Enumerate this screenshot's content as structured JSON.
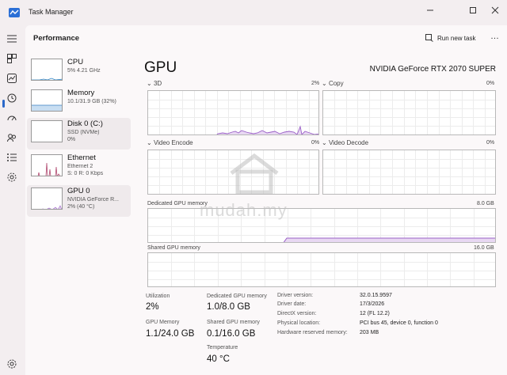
{
  "window": {
    "title": "Task Manager",
    "minimize_icon": "minimize-icon",
    "maximize_icon": "maximize-icon",
    "close_icon": "close-icon"
  },
  "rail": [
    "hamburger-icon",
    "processes-icon",
    "performance-icon",
    "app-history-icon",
    "startup-apps-icon",
    "users-icon",
    "details-icon",
    "services-icon",
    "settings-icon"
  ],
  "header": {
    "title": "Performance",
    "run_new_task": "Run new task",
    "more": "…"
  },
  "sidebar": {
    "items": [
      {
        "name": "CPU",
        "line1": "5% 4.21 GHz",
        "line2": ""
      },
      {
        "name": "Memory",
        "line1": "10.1/31.9 GB (32%)",
        "line2": ""
      },
      {
        "name": "Disk 0 (C:)",
        "line1": "SSD (NVMe)",
        "line2": "0%"
      },
      {
        "name": "Ethernet",
        "line1": "Ethernet 2",
        "line2": "S: 0 R: 0 Kbps"
      },
      {
        "name": "GPU 0",
        "line1": "NVIDIA GeForce R...",
        "line2": "2% (40 °C)"
      }
    ]
  },
  "main": {
    "title": "GPU",
    "model": "NVIDIA GeForce RTX 2070 SUPER",
    "engines": [
      {
        "label": "3D",
        "value": "2%"
      },
      {
        "label": "Copy",
        "value": "0%"
      },
      {
        "label": "Video Encode",
        "value": "0%"
      },
      {
        "label": "Video Decode",
        "value": "0%"
      }
    ],
    "dedicated_label": "Dedicated GPU memory",
    "dedicated_max": "8.0 GB",
    "shared_label": "Shared GPU memory",
    "shared_max": "16.0 GB",
    "stats": {
      "utilization_label": "Utilization",
      "utilization_value": "2%",
      "gpu_memory_label": "GPU Memory",
      "gpu_memory_value": "1.1/24.0 GB",
      "dedicated_label": "Dedicated GPU memory",
      "dedicated_value": "1.0/8.0 GB",
      "shared_label": "Shared GPU memory",
      "shared_value": "0.1/16.0 GB",
      "temperature_label": "Temperature",
      "temperature_value": "40 °C"
    },
    "info": [
      {
        "label": "Driver version:",
        "value": "32.0.15.9597"
      },
      {
        "label": "Driver date:",
        "value": "17/3/2026"
      },
      {
        "label": "DirectX version:",
        "value": "12 (FL 12.2)"
      },
      {
        "label": "Physical location:",
        "value": "PCI bus 45, device 0, function 0"
      },
      {
        "label": "Hardware reserved memory:",
        "value": "203 MB"
      }
    ]
  },
  "watermark": "mudah.my",
  "colors": {
    "gpu_accent": "#9a5fc7",
    "gpu_fill": "#e8d8f2",
    "memory_fill": "#c8def2",
    "ethernet_line": "#b0476e",
    "cpu_line": "#2f86c8"
  }
}
